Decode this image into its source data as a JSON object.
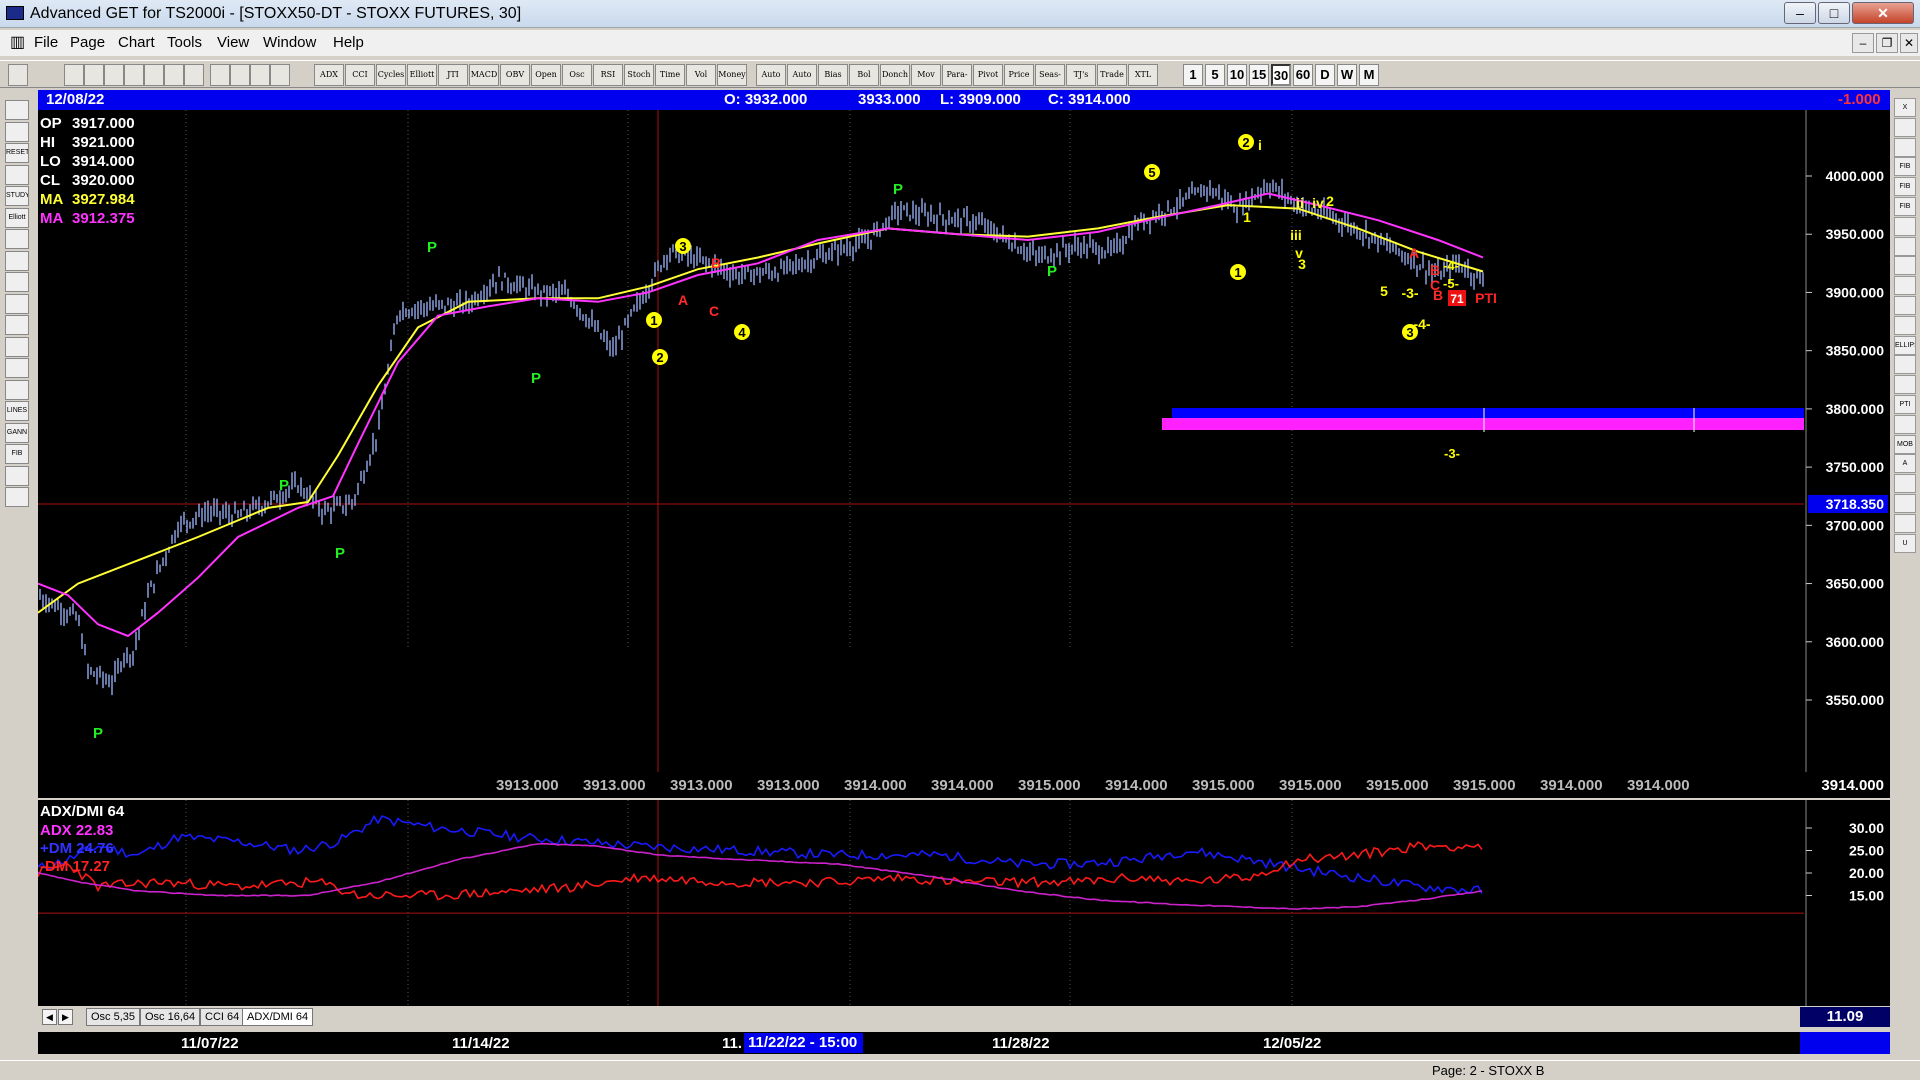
{
  "window": {
    "title": "Advanced GET for TS2000i - [STOXX50-DT - STOXX FUTURES, 30]",
    "min_label": "–",
    "max_label": "□",
    "close_label": "✕"
  },
  "menu": {
    "items": [
      "File",
      "Page",
      "Chart",
      "Tools",
      "View",
      "Window",
      "Help"
    ],
    "mdi_min": "–",
    "mdi_restore": "❐",
    "mdi_close": "✕"
  },
  "toolbar": {
    "studies": [
      "ADX DMI",
      "CCI",
      "Cycles",
      "Elliott Trig",
      "JTI",
      "MACD",
      "OBV",
      "Open Int",
      "Osc",
      "RSI",
      "Stoch",
      "Time Clust",
      "Vol",
      "Money Flow",
      "Auto Gann",
      "Auto Trend",
      "Bias",
      "Bol Band",
      "Donch",
      "Mov Ave",
      "Para- bolic",
      "Pivot",
      "Price Clust",
      "Seas- onals",
      "TJ's Web",
      "Trade Profile",
      "XTL"
    ],
    "timeframes": [
      "1",
      "5",
      "10",
      "15",
      "30",
      "60",
      "D",
      "W",
      "M"
    ],
    "selected_timeframe": "30"
  },
  "left_tools": [
    "",
    "",
    "RESET",
    "",
    "STUDY",
    "Elliott",
    "",
    "",
    "",
    "",
    "",
    "",
    "",
    "",
    "LINES",
    "GANN",
    "FIB",
    "",
    ""
  ],
  "right_tools": [
    "X",
    "",
    "",
    "FIB RET",
    "FIB EXT",
    "FIB TIME",
    "",
    "",
    "",
    "",
    "",
    "",
    "ELLIPS",
    "",
    "",
    "PTI",
    "",
    "MOB",
    "A",
    "",
    "",
    "",
    "U"
  ],
  "infobar": {
    "date": "12/08/22",
    "open": "O: 3932.000",
    "high": "3933.000",
    "low": "L: 3909.000",
    "close": "C: 3914.000",
    "change": "-1.000"
  },
  "price_panel": {
    "stats": [
      {
        "label": "OP",
        "value": "3917.000",
        "color": "#ffffff"
      },
      {
        "label": "HI",
        "value": "3921.000",
        "color": "#ffffff"
      },
      {
        "label": "LO",
        "value": "3914.000",
        "color": "#ffffff"
      },
      {
        "label": "CL",
        "value": "3920.000",
        "color": "#ffffff"
      },
      {
        "label": "MA",
        "value": "3927.984",
        "color": "#ffff33"
      },
      {
        "label": "MA",
        "value": "3912.375",
        "color": "#ff33ff"
      }
    ],
    "axis_ticks": [
      "4000.000",
      "3950.000",
      "3900.000",
      "3850.000",
      "3800.000",
      "3750.000",
      "3700.000",
      "3650.000",
      "3600.000",
      "3550.000"
    ],
    "cursor_price": "3718.350",
    "bottom_values": [
      "3913.000",
      "3913.000",
      "3913.000",
      "3913.000",
      "3914.000",
      "3914.000",
      "3915.000",
      "3914.000",
      "3915.000",
      "3915.000",
      "3915.000",
      "3915.000",
      "3914.000",
      "3914.000"
    ],
    "last_value": "3914.000",
    "pivot_label": "P",
    "wave_labels_yellow": [
      "1",
      "2",
      "3",
      "4",
      "5",
      "1",
      "2",
      "3",
      "i",
      "ii",
      "iii",
      "iv",
      "v",
      "1",
      "2",
      "3",
      "5",
      "-3-",
      "-4-",
      "-4-",
      "-5-",
      "-3-"
    ],
    "abc_labels_red": [
      "A",
      "B",
      "C",
      "A",
      "B",
      "C",
      "B"
    ],
    "pti_label": "PTI",
    "pti_value": "71"
  },
  "adx_panel": {
    "title": "ADX/DMI 64",
    "adx": "ADX 22.83",
    "pdm": "+DM 24.76",
    "mdm": "-DM 17.27",
    "axis_ticks": [
      "30.00",
      "25.00",
      "20.00",
      "15.00"
    ],
    "current": "11.09"
  },
  "tabs": [
    "Osc 5,35",
    "Osc 16,64",
    "CCI 64",
    "ADX/DMI 64"
  ],
  "active_tab": "ADX/DMI 64",
  "dates": {
    "labels": [
      "11/07/22",
      "11/14/22",
      "11/28/22",
      "12/05/22"
    ],
    "cursor_prefix": "11.",
    "cursor": "11/22/22 - 15:00"
  },
  "status": {
    "page": "Page: 2 - STOXX B"
  },
  "colors": {
    "ma_fast": "#ffff33",
    "ma_slow": "#ff33ff",
    "bars": "#a0b8ff",
    "pdm": "#1a1aff",
    "mdm": "#ff1a1a",
    "adx": "#cc22cc",
    "pivot": "#22ee22",
    "wave": "#ffff00",
    "abc": "#ff2a2a",
    "infobar": "#0000ee"
  }
}
